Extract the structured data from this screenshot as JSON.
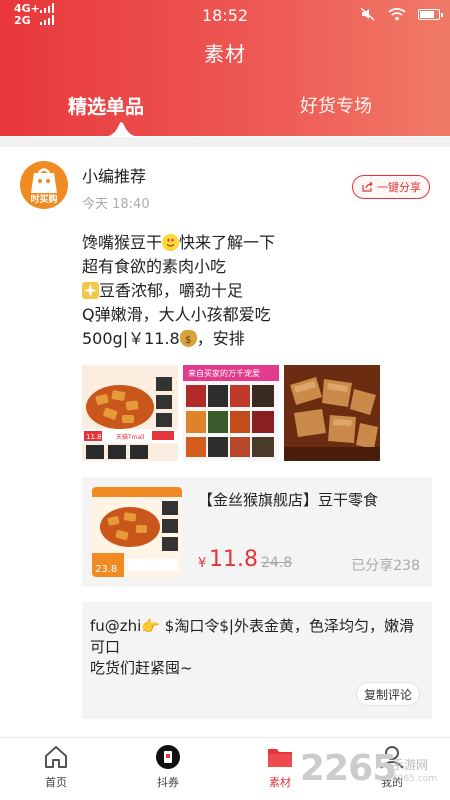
{
  "status_bar": {
    "network_top": "4G+",
    "network_bottom": "2G",
    "time": "18:52"
  },
  "header": {
    "title": "素材",
    "tabs": [
      {
        "label": "精选单品",
        "active": true
      },
      {
        "label": "好货专场",
        "active": false
      }
    ],
    "colors": {
      "accent": "#e8373b"
    }
  },
  "post": {
    "author": "小编推荐",
    "avatar_text": "时买购",
    "time": "今天 18:40",
    "share_label": "一键分享",
    "lines": [
      {
        "before": "馋嘴猴豆干",
        "emoji": "heart-eyes-emoji",
        "after": "快来了解一下"
      },
      {
        "before": "超有食欲的素肉小吃",
        "emoji": "",
        "after": ""
      },
      {
        "before": "",
        "emoji": "sparkle-emoji",
        "after": "豆香浓郁，嚼劲十足"
      },
      {
        "before": "Q弹嫩滑，大人小孩都爱吃",
        "emoji": "",
        "after": ""
      },
      {
        "before": "500g|￥11.8",
        "emoji": "money-bag-emoji",
        "after": "，安排"
      }
    ],
    "images": [
      {
        "name": "spicy-tofu-product-image",
        "label": "天猫Tmall"
      },
      {
        "name": "tofu-flavors-grid-image",
        "label": "来自买家的万千宠爱"
      },
      {
        "name": "tofu-closeup-image",
        "label": ""
      }
    ]
  },
  "product": {
    "title": "【金丝猴旗舰店】豆干零食",
    "currency": "¥",
    "price": "11.8",
    "original_price": "24.8",
    "shared": "已分享238",
    "thumb_price": "23.8"
  },
  "comment": {
    "text": "fu@zhi👉 $淘口令$|外表金黄，色泽均匀，嫩滑可口\n吃货们赶紧囤~",
    "copy_label": "复制评论"
  },
  "tabbar": {
    "items": [
      {
        "label": "首页",
        "icon": "home-icon",
        "active": false
      },
      {
        "label": "抖券",
        "icon": "douyin-icon",
        "active": false
      },
      {
        "label": "素材",
        "icon": "folder-icon",
        "active": true
      },
      {
        "label": "我的",
        "icon": "user-icon",
        "active": false
      }
    ]
  },
  "watermark": {
    "number": "2265",
    "site": "手游网",
    "url": "2265.com"
  }
}
